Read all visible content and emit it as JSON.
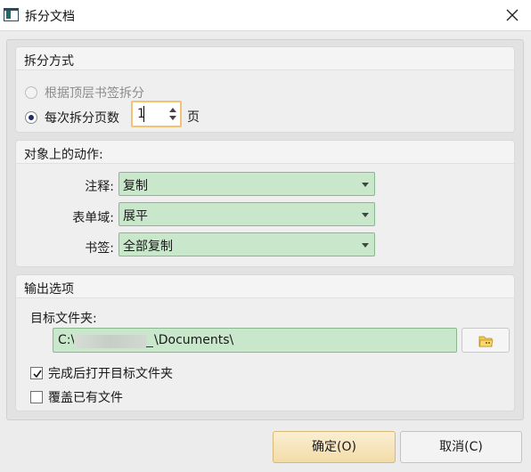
{
  "window": {
    "title": "拆分文档",
    "close_icon": "close-icon",
    "app_icon": "document-window-icon"
  },
  "split_method": {
    "title": "拆分方式",
    "by_bookmark_label": "根据顶层书签拆分",
    "by_bookmark_selected": false,
    "by_bookmark_enabled": false,
    "by_pages_label": "每次拆分页数",
    "by_pages_selected": true,
    "pages_value": "1",
    "pages_unit": "页"
  },
  "object_actions": {
    "title": "对象上的动作:",
    "annotation_label": "注释:",
    "annotation_value": "复制",
    "form_field_label": "表单域:",
    "form_field_value": "展平",
    "bookmark_label": "书签:",
    "bookmark_value": "全部复制"
  },
  "output": {
    "title": "输出选项",
    "target_folder_label": "目标文件夹:",
    "path_prefix": "C:\\",
    "path_suffix": "\\Documents\\",
    "browse_icon": "folder-browse-icon",
    "open_folder_label": "完成后打开目标文件夹",
    "open_folder_checked": true,
    "overwrite_label": "覆盖已有文件",
    "overwrite_checked": false
  },
  "buttons": {
    "ok_label": "确定(O)",
    "cancel_label": "取消(C)"
  },
  "colors": {
    "combo_bg": "#c9e8cb",
    "spin_focus_border": "#f0c472",
    "ok_button_bg": "#f2dca8",
    "radio_dot": "#1d2c6b"
  }
}
